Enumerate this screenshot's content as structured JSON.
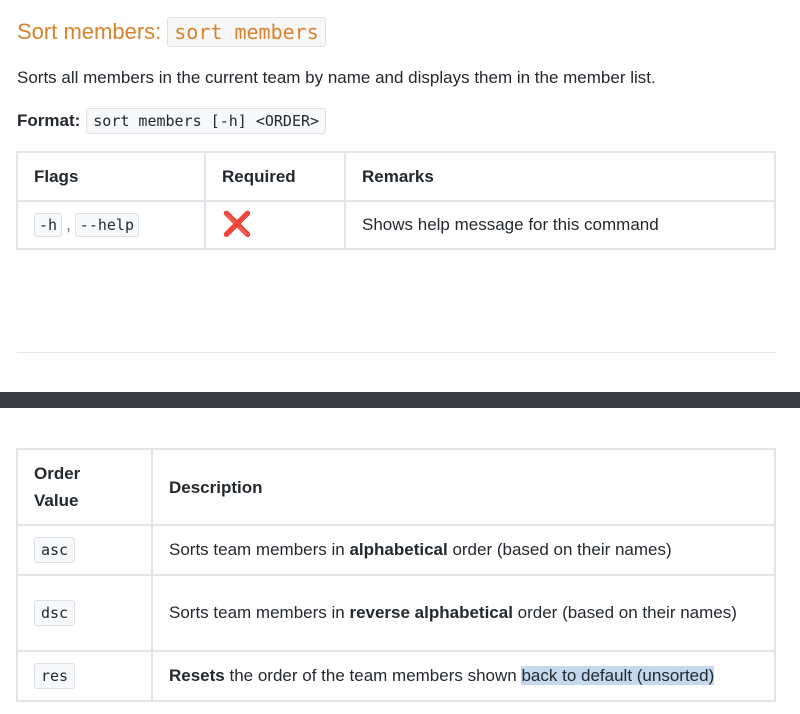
{
  "heading": {
    "text": "Sort members:",
    "code": "sort members"
  },
  "description": "Sorts all members in the current team by name and displays them in the member list.",
  "format": {
    "label": "Format:",
    "code": "sort members [-h] <ORDER>"
  },
  "flags_table": {
    "headers": [
      "Flags",
      "Required",
      "Remarks"
    ],
    "row": {
      "flag_short": "-h",
      "separator": ",",
      "flag_long": "--help",
      "required_icon": "❌",
      "remarks": "Shows help message for this command"
    }
  },
  "order_table": {
    "headers": {
      "order_line1": "Order",
      "order_line2": "Value",
      "description": "Description"
    },
    "rows": [
      {
        "value": "asc",
        "pre": "Sorts team members in ",
        "bold": "alphabetical",
        "post": " order (based on their names)"
      },
      {
        "value": "dsc",
        "pre": "Sorts team members in ",
        "bold": "reverse alphabetical",
        "post": " order (based on their names)"
      },
      {
        "value": "res",
        "bold": "Resets",
        "pre": " the order of the team members shown ",
        "highlight": "back to default (unsorted)"
      }
    ]
  },
  "colors": {
    "heading": "#d9822b",
    "cross": "#d63a2f",
    "highlight": "#c5d9ee",
    "band": "#3a3d41"
  }
}
